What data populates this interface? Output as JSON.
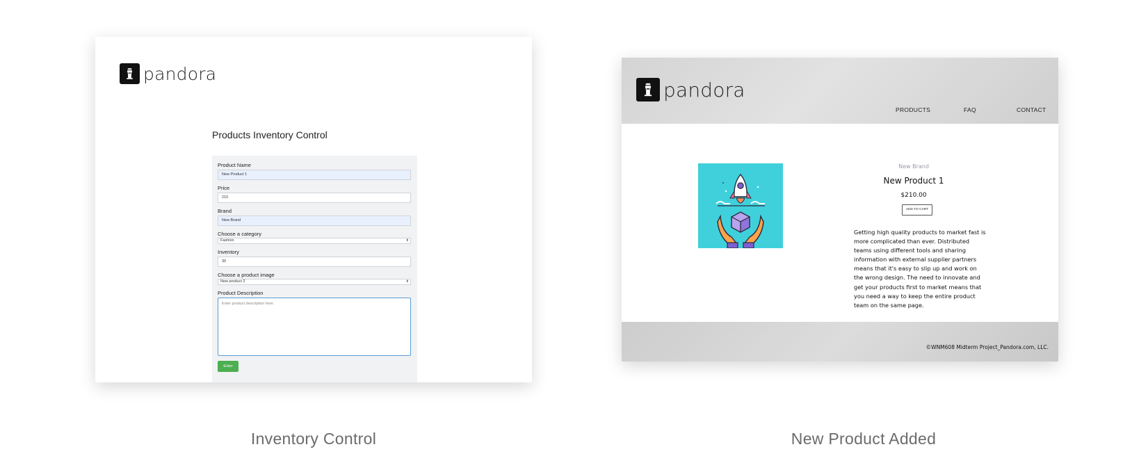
{
  "inventory_screen": {
    "logo_text": "pandora",
    "title": "Products Inventory Control",
    "form": {
      "product_name_label": "Product Name",
      "product_name_value": "New Product 1",
      "price_label": "Price",
      "price_value": "210",
      "brand_label": "Brand",
      "brand_value": "New Brand",
      "category_label": "Choose a category",
      "category_value": "Fashion",
      "inventory_label": "Inventory",
      "inventory_value": "30",
      "image_label": "Choose a product image",
      "image_value": "New product 2",
      "description_label": "Product Description",
      "description_placeholder": "Enter product description here.",
      "submit_label": "Enter"
    },
    "caption": "Inventory Control"
  },
  "product_screen": {
    "logo_text": "pandora",
    "nav": [
      "PRODUCTS",
      "FAQ",
      "CONTACT"
    ],
    "brand": "New Brand",
    "name": "New Product 1",
    "price": "$210.00",
    "add_to_cart_label": "ADD TO CART",
    "description": "Getting high quality products to market fast is more complicated than ever. Distributed teams using different tools and sharing information with external supplier partners means that it's easy to slip up and work on the wrong design. The need to innovate and get your products first to market means that you need a way to keep the entire product team on the same page.",
    "footer": "©WNM608 Midterm Project_Pandora.com, LLC.",
    "caption": "New Product Added",
    "image_icon": "rocket-box-hands-illustration"
  },
  "colors": {
    "submit_green": "#4caf50",
    "autofill_blue": "#e8f0fe",
    "focus_blue": "#5b9bd5",
    "product_image_bg": "#3fd0dc"
  }
}
